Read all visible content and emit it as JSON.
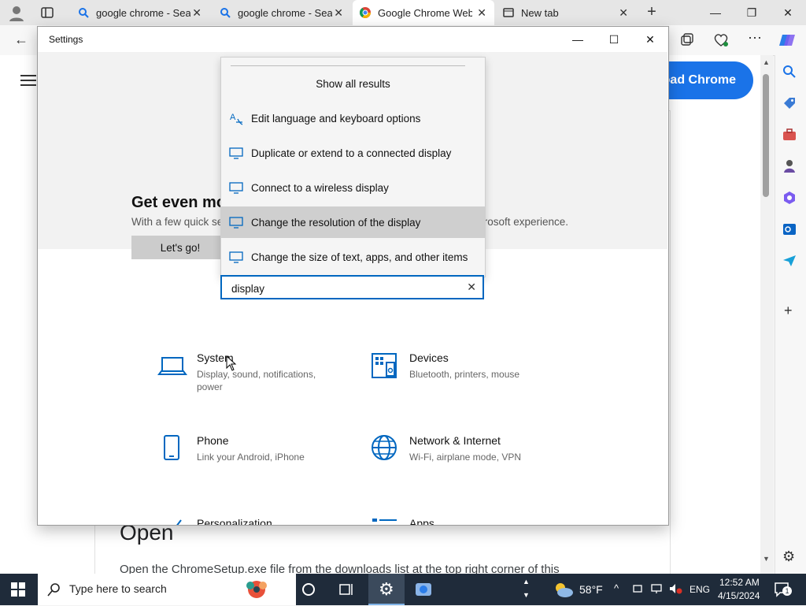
{
  "browser": {
    "tabs": [
      {
        "label": "google chrome - Sear",
        "icon": "search-icon"
      },
      {
        "label": "google chrome - Sear",
        "icon": "search-icon"
      },
      {
        "label": "Google Chrome Web",
        "icon": "chrome-icon",
        "active": true
      },
      {
        "label": "New tab",
        "icon": "newtab-icon"
      }
    ],
    "download_button": "oad Chrome"
  },
  "page": {
    "open_heading": "Open",
    "open_text": "Open the ChromeSetup.exe file from the downloads list at the top right corner of this"
  },
  "settings": {
    "window_title": "Settings",
    "banner": {
      "heading": "Get even mo",
      "sub_left": "With a few quick se",
      "sub_right": "crosoft experience.",
      "button": "Let's go!"
    },
    "categories": [
      {
        "title": "System",
        "desc": "Display, sound, notifications, power",
        "icon": "laptop-icon"
      },
      {
        "title": "Devices",
        "desc": "Bluetooth, printers, mouse",
        "icon": "keyboard-printer-icon"
      },
      {
        "title": "Phone",
        "desc": "Link your Android, iPhone",
        "icon": "phone-icon"
      },
      {
        "title": "Network & Internet",
        "desc": "Wi-Fi, airplane mode, VPN",
        "icon": "globe-icon"
      },
      {
        "title": "Personalization",
        "desc": "",
        "icon": "brush-icon"
      },
      {
        "title": "Apps",
        "desc": "",
        "icon": "apps-icon"
      }
    ]
  },
  "search": {
    "value": "display",
    "show_all": "Show all results",
    "results": [
      {
        "label": "Edit language and keyboard options",
        "icon": "language-icon"
      },
      {
        "label": "Duplicate or extend to a connected display",
        "icon": "monitor-icon"
      },
      {
        "label": "Connect to a wireless display",
        "icon": "monitor-icon"
      },
      {
        "label": "Change the resolution of the display",
        "icon": "monitor-icon",
        "selected": true
      },
      {
        "label": "Change the size of text, apps, and other items",
        "icon": "monitor-icon"
      }
    ]
  },
  "taskbar": {
    "search_placeholder": "Type here to search",
    "weather": "58°F",
    "language": "ENG",
    "time": "12:52 AM",
    "date": "4/15/2024",
    "notification_count": "1"
  },
  "colors": {
    "accent": "#0067c0",
    "chrome_button": "#1a73e8",
    "taskbar": "#1f2b3a"
  }
}
